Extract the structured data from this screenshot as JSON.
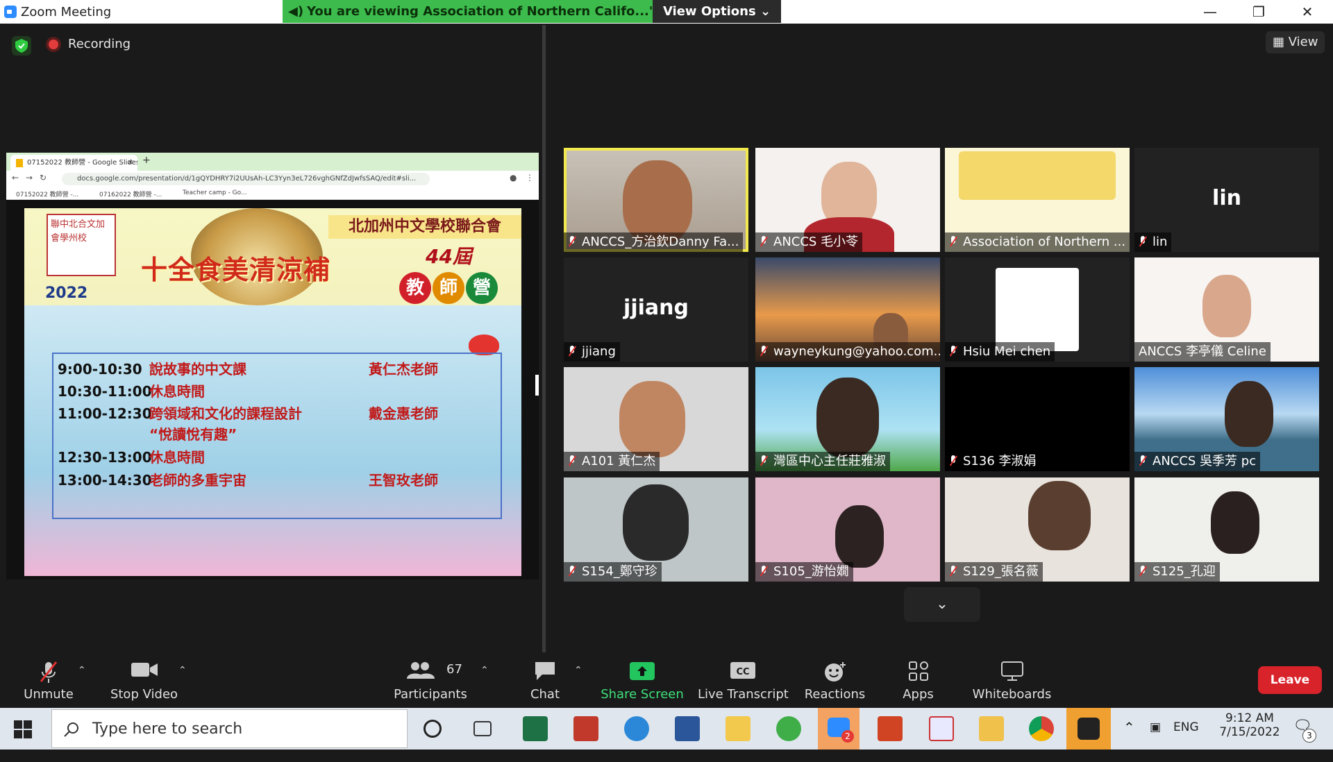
{
  "window": {
    "title": "Zoom Meeting"
  },
  "banner": {
    "text": "You are viewing Association of Northern Califo...'s screen",
    "view_options": "View Options"
  },
  "status": {
    "recording": "Recording",
    "view": "View"
  },
  "shared_screen": {
    "tab_title": "07152022 教師營 - Google Slides",
    "url": "docs.google.com/presentation/d/1gQYDHRY7i2UUsAh-LC3Yyn3eL726vghGNfZdJwfsSAQ/edit#sli...",
    "bookmarks": [
      "07152022 教師營 -...",
      "07162022 教師營 -...",
      "Teacher camp - Go..."
    ],
    "slide": {
      "org": "北加州中文學校聯合會",
      "title": "十全食美清涼補",
      "edition": "44屆",
      "camp": [
        "教",
        "師",
        "營"
      ],
      "year": "2022",
      "crest": "聯中北合文加會學州校",
      "schedule": [
        {
          "time": "9:00-10:30",
          "session": "說故事的中文課",
          "teacher": "黃仁杰老師"
        },
        {
          "time": "10:30-11:00",
          "session": "休息時間",
          "teacher": ""
        },
        {
          "time": "11:00-12:30",
          "session": "跨領域和文化的課程設計",
          "teacher": "戴金惠老師"
        },
        {
          "time": "",
          "session": "“悅讀悅有趣”",
          "teacher": ""
        },
        {
          "time": "12:30-13:00",
          "session": "休息時間",
          "teacher": ""
        },
        {
          "time": "13:00-14:30",
          "session": "老師的多重宇宙",
          "teacher": "王智玫老師"
        }
      ]
    }
  },
  "participants_grid": [
    {
      "name": "ANCCS_方治欽Danny Fa...",
      "active": true
    },
    {
      "name": "ANCCS 毛小苓"
    },
    {
      "name": "Association of Northern ..."
    },
    {
      "name": "lin",
      "display": "lin"
    },
    {
      "name": "jjiang",
      "display": "jjiang"
    },
    {
      "name": "wayneykung@yahoo.com..."
    },
    {
      "name": "Hsiu Mei chen"
    },
    {
      "name": "ANCCS 李亭儀 Celine"
    },
    {
      "name": "A101 黃仁杰"
    },
    {
      "name": "灣區中心主任莊雅淑"
    },
    {
      "name": "S136 李淑娟"
    },
    {
      "name": "ANCCS 吳季芳 pc"
    },
    {
      "name": "S154_鄭守珍"
    },
    {
      "name": "S105_游怡嫺"
    },
    {
      "name": "S129_張名薇"
    },
    {
      "name": "S125_孔迎"
    }
  ],
  "toolbar": {
    "unmute": "Unmute",
    "stop_video": "Stop Video",
    "participants": "Participants",
    "participant_count": "67",
    "chat": "Chat",
    "share_screen": "Share Screen",
    "live_transcript": "Live Transcript",
    "reactions": "Reactions",
    "apps": "Apps",
    "whiteboards": "Whiteboards",
    "leave": "Leave"
  },
  "taskbar": {
    "search_placeholder": "Type here to search",
    "lang": "ENG",
    "time": "9:12 AM",
    "date": "7/15/2022",
    "notifications": "3",
    "teams_badge": "2"
  },
  "colors": {
    "banner_green": "#3dbb4c",
    "leave_red": "#d9232b",
    "share_green": "#22c55e",
    "active_speaker": "#f2e94e"
  }
}
